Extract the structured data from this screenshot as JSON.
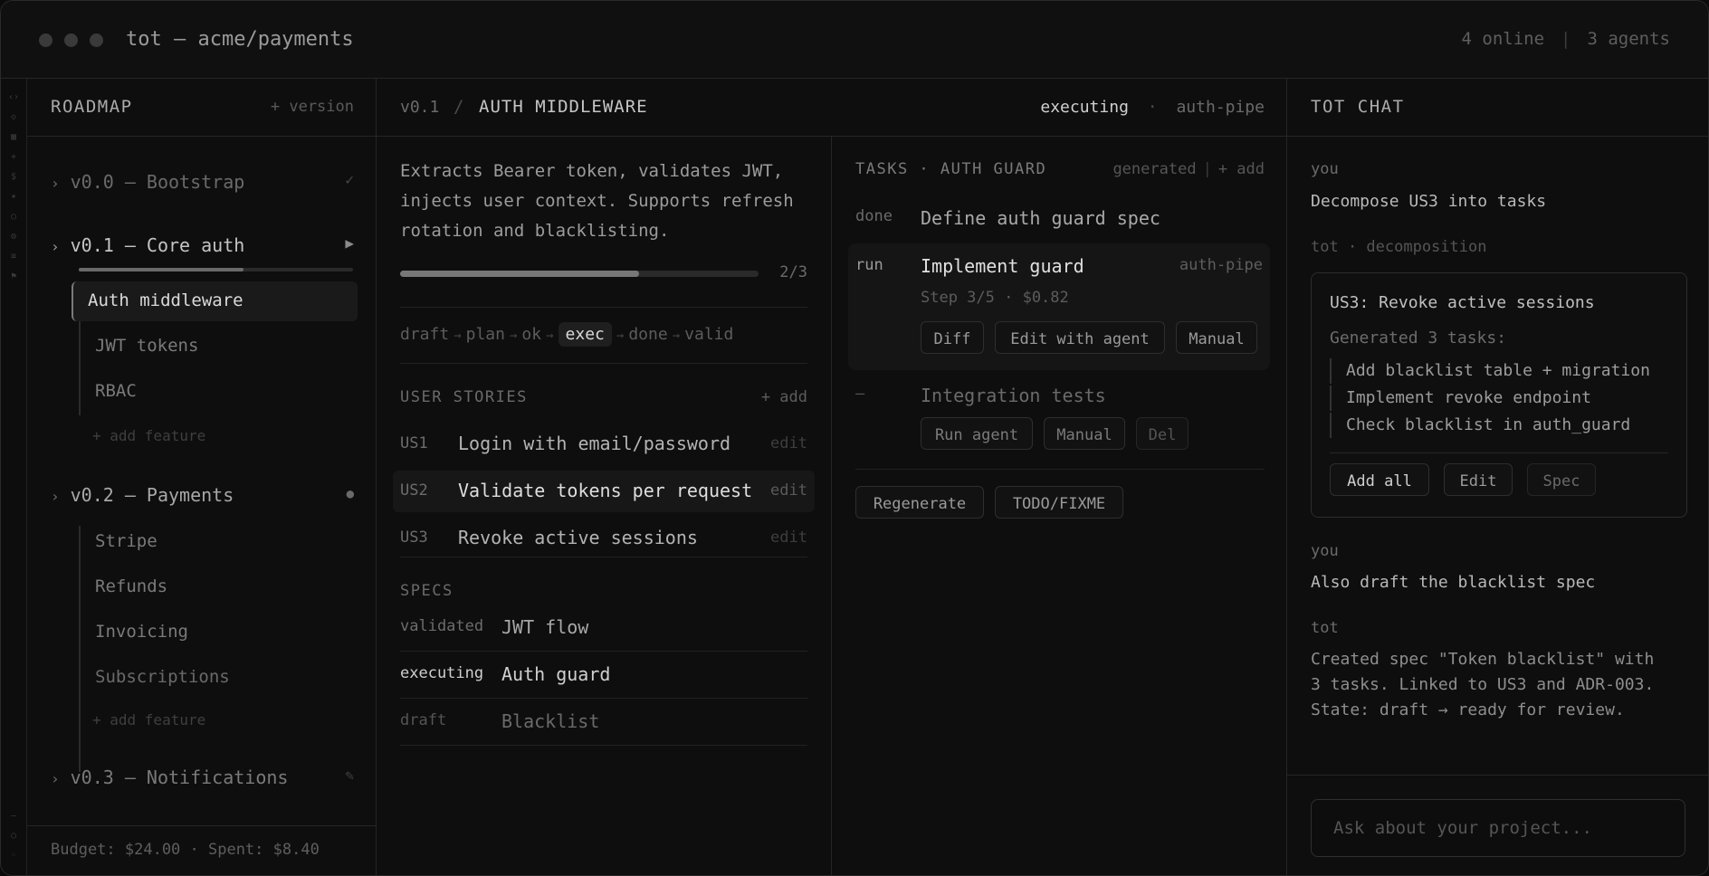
{
  "window": {
    "title": "tot — acme/payments",
    "online": "4 online",
    "separator": "|",
    "agents": "3 agents"
  },
  "roadmap": {
    "header": "ROADMAP",
    "add_version": "+ version",
    "versions": [
      {
        "label": "v0.0 — Bootstrap",
        "state": "✓"
      },
      {
        "label": "v0.1 — Core auth",
        "state": "▶"
      },
      {
        "label": "v0.2 — Payments",
        "state": "●"
      },
      {
        "label": "v0.3 — Notifications",
        "state": "✎"
      }
    ],
    "v01_features": [
      "Auth middleware",
      "JWT tokens",
      "RBAC"
    ],
    "v01_progress": 0.6,
    "v02_features": [
      "Stripe",
      "Refunds",
      "Invoicing",
      "Subscriptions"
    ],
    "add_feature": "+ add feature",
    "footer": "Budget: $24.00 · Spent: $8.40"
  },
  "main": {
    "breadcrumb_version": "v0.1",
    "breadcrumb_sep": "/",
    "title": "AUTH MIDDLEWARE",
    "status": "executing",
    "status_sep": "·",
    "pipeline_name": "auth-pipe",
    "description": "Extracts Bearer token, validates JWT, injects user context. Supports refresh rotation and blacklisting.",
    "progress_label": "2/3",
    "progress": 0.667,
    "pipeline": [
      "draft",
      "plan",
      "ok",
      "exec",
      "done",
      "valid"
    ],
    "pipeline_arrow": "→",
    "stories_header": "USER STORIES",
    "stories_add": "+ add",
    "stories": [
      {
        "id": "US1",
        "text": "Login with email/password",
        "edit": "edit"
      },
      {
        "id": "US2",
        "text": "Validate tokens per request",
        "edit": "edit"
      },
      {
        "id": "US3",
        "text": "Revoke active sessions",
        "edit": "edit"
      }
    ],
    "specs_header": "SPECS",
    "specs": [
      {
        "state": "validated",
        "name": "JWT flow"
      },
      {
        "state": "executing",
        "name": "Auth guard"
      },
      {
        "state": "draft",
        "name": "Blacklist"
      }
    ]
  },
  "tasks": {
    "header": "TASKS · AUTH GUARD",
    "generated": "generated",
    "sep": "|",
    "add": "+ add",
    "items": [
      {
        "state": "done",
        "name": "Define auth guard spec"
      },
      {
        "state": "run",
        "name": "Implement guard",
        "tag": "auth-pipe",
        "meta": "Step 3/5 · $0.82",
        "buttons": [
          "Diff",
          "Edit with agent",
          "Manual"
        ]
      },
      {
        "state": "—",
        "name": "Integration tests",
        "buttons": [
          "Run agent",
          "Manual",
          "Del"
        ]
      }
    ],
    "regenerate": "Regenerate",
    "todo": "TODO/FIXME"
  },
  "chat": {
    "header": "TOT CHAT",
    "msg1_who": "you",
    "msg1_text": "Decompose US3 into tasks",
    "msg2_who": "tot · decomposition",
    "card_title": "US3: Revoke active sessions",
    "card_sub": "Generated 3 tasks:",
    "card_items": [
      "Add blacklist table + migration",
      "Implement revoke endpoint",
      "Check blacklist in auth_guard"
    ],
    "card_buttons": [
      "Add all",
      "Edit",
      "Spec"
    ],
    "msg3_who": "you",
    "msg3_text": "Also draft the blacklist spec",
    "msg4_who": "tot",
    "msg4_text": "Created spec \"Token blacklist\" with 3 tasks. Linked to US3 and ADR-003. State: draft → ready for review.",
    "input_placeholder": "Ask about your project..."
  }
}
